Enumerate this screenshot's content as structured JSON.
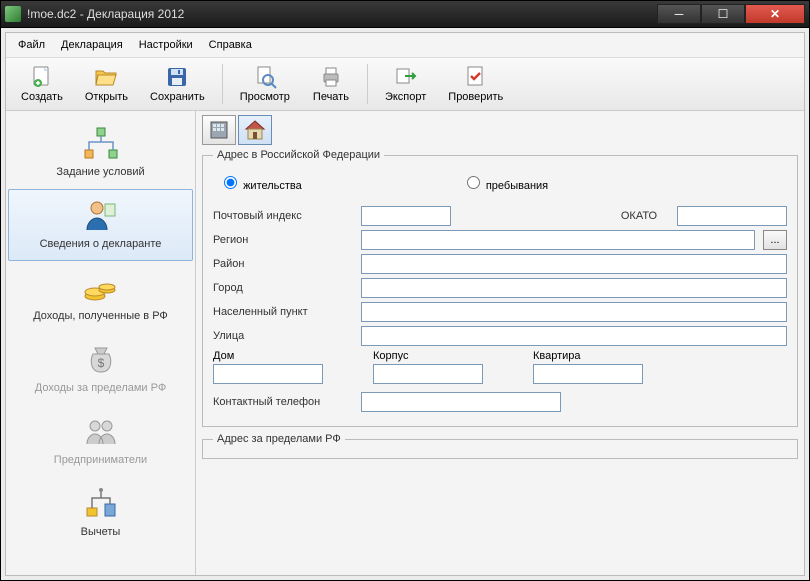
{
  "window": {
    "title": "!moe.dc2 - Декларация 2012"
  },
  "menu": {
    "file": "Файл",
    "decl": "Декларация",
    "settings": "Настройки",
    "help": "Справка"
  },
  "toolbar": {
    "create": "Создать",
    "open": "Открыть",
    "save": "Сохранить",
    "preview": "Просмотр",
    "print": "Печать",
    "export": "Экспорт",
    "check": "Проверить"
  },
  "sidebar": {
    "conditions": "Задание условий",
    "declarant": "Сведения о декларанте",
    "income_rf": "Доходы, полученные в РФ",
    "income_abroad": "Доходы за пределами РФ",
    "entrepreneurs": "Предприниматели",
    "deductions": "Вычеты"
  },
  "form": {
    "group_rf_title": "Адрес в Российской Федерации",
    "radio_residence": "жительства",
    "radio_stay": "пребывания",
    "postal_index": "Почтовый индекс",
    "okato": "ОКАТО",
    "region": "Регион",
    "district": "Район",
    "city": "Город",
    "settlement": "Населенный пункт",
    "street": "Улица",
    "house": "Дом",
    "building": "Корпус",
    "apartment": "Квартира",
    "phone": "Контактный телефон",
    "group_abroad_title": "Адрес за пределами РФ",
    "ellipsis": "..."
  },
  "values": {
    "postal_index": "",
    "okato": "",
    "region": "",
    "district": "",
    "city": "",
    "settlement": "",
    "street": "",
    "house": "",
    "building": "",
    "apartment": "",
    "phone": ""
  }
}
